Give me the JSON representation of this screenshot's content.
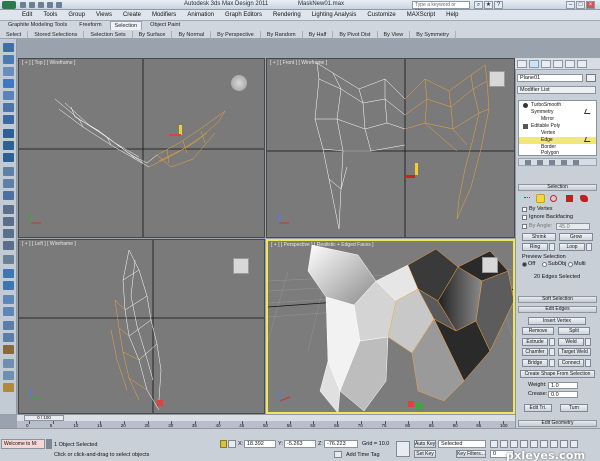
{
  "titlebar": {
    "title": "Autodesk 3ds Max Design 2011",
    "file": "MaskNew01.max",
    "search_placeholder": "Type a keyword or phrase"
  },
  "menu": [
    "Edit",
    "Tools",
    "Group",
    "Views",
    "Create",
    "Modifiers",
    "Animation",
    "Graph Editors",
    "Rendering",
    "Lighting Analysis",
    "Customize",
    "MAXScript",
    "Help"
  ],
  "ribbon": {
    "tabs": [
      "Graphite Modeling Tools",
      "Freeform",
      "Selection",
      "Object Paint"
    ],
    "active_tab": 2,
    "bar": [
      "Select",
      "Stored Selections",
      "Selection Sets",
      "By Surface",
      "By Normal",
      "By Perspective",
      "By Random",
      "By Half",
      "By Pivot Dist",
      "By View",
      "By Symmetry"
    ]
  },
  "viewports": {
    "top": "[ + ] [ Top ] [ Wireframe ]",
    "front": "[ + ] [ Front ] [ Wireframe ]",
    "left": "[ + ] [ Left ] [ Wireframe ]",
    "persp": "[ + ] [ Perspective ] [ Realistic + Edged Faces ]"
  },
  "command_panel": {
    "object_name": "Plane01",
    "modifier_list": "Modifier List",
    "stack": [
      "TurboSmooth",
      "Symmetry",
      "Mirror",
      "Editable Poly",
      "Vertex",
      "Edge",
      "Border",
      "Polygon"
    ],
    "selected_stack_item": "Edge",
    "selection_header": "Selection",
    "by_vertex": "By Vertex",
    "ignore_backfacing": "Ignore Backfacing",
    "by_angle": "By Angle:",
    "by_angle_value": "45.0",
    "shrink": "Shrink",
    "grow": "Grow",
    "ring": "Ring",
    "loop": "Loop",
    "preview_selection": "Preview Selection",
    "preview_off": "Off",
    "preview_subobj": "SubObj",
    "preview_multi": "Multi",
    "edges_selected": "20 Edges Selected",
    "soft_selection": "Soft Selection",
    "edit_edges": "Edit Edges",
    "insert_vertex": "Insert Vertex",
    "remove": "Remove",
    "split": "Split",
    "extrude": "Extrude",
    "weld": "Weld",
    "chamfer": "Chamfer",
    "target_weld": "Target Weld",
    "bridge": "Bridge",
    "connect": "Connect",
    "create_shape": "Create Shape From Selection",
    "weight_label": "Weight:",
    "weight_value": "1.0",
    "crease_label": "Crease:",
    "crease_value": "0.0",
    "edit_tri": "Edit Tri.",
    "turn": "Turn",
    "edit_geometry": "Edit Geometry"
  },
  "timeline": {
    "frame": "0 / 100",
    "ticks": [
      "0",
      "5",
      "10",
      "15",
      "20",
      "25",
      "30",
      "35",
      "40",
      "45",
      "50",
      "55",
      "60",
      "65",
      "70",
      "75",
      "80",
      "85",
      "90",
      "95",
      "100"
    ]
  },
  "status": {
    "maxscript": "Welcome to M:",
    "selected": "1 Object Selected",
    "prompt": "Click or click-and-drag to select objects",
    "x_label": "X:",
    "x": "18.392",
    "y_label": "Y:",
    "y": "-5.263",
    "z_label": "Z:",
    "z": "-76.223",
    "grid": "Grid = 10.0",
    "add_time_tag": "Add Time Tag",
    "auto_key": "Auto Key",
    "set_key": "Set Key",
    "selected_dropdown": "Selected",
    "key_filters": "Key Filters...",
    "frame_field": "0"
  },
  "watermark": "pxleyes.com"
}
